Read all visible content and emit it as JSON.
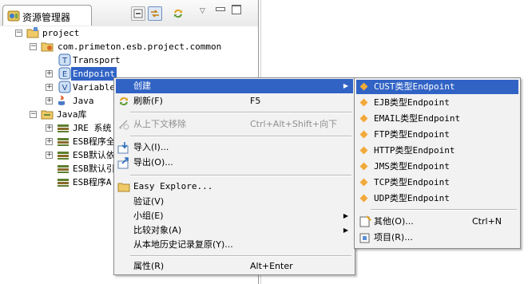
{
  "explorer": {
    "title": "资源管理器",
    "tree": {
      "project": "project",
      "package": "com.primeton.esb.project.common",
      "transport": "Transport",
      "endpoint": "Endpoint",
      "variable": "Variable",
      "java": "Java",
      "java_lib": "Java库",
      "jre": "JRE 系统",
      "esb_prog1": "ESB程序全",
      "esb_default1": "ESB默认依",
      "esb_default2": "ESB默认引",
      "esb_prog2": "ESB程序A"
    }
  },
  "context_menu": {
    "items": [
      {
        "label": "创建",
        "shortcut": "",
        "icon": "none",
        "submenu": true,
        "state": "highlighted"
      },
      {
        "label": "刷新(F)",
        "shortcut": "F5",
        "icon": "refresh-icon"
      },
      {
        "label": "从上下文移除",
        "shortcut": "Ctrl+Alt+Shift+向下",
        "icon": "remove-context-icon",
        "state": "disabled"
      },
      {
        "label": "导入(I)...",
        "shortcut": "",
        "icon": "import-icon"
      },
      {
        "label": "导出(O)...",
        "shortcut": "",
        "icon": "export-icon"
      },
      {
        "label": "Easy Explore...",
        "shortcut": "",
        "icon": "folder-icon"
      },
      {
        "label": "验证(V)",
        "shortcut": "",
        "icon": "none"
      },
      {
        "label": "小组(E)",
        "shortcut": "",
        "icon": "none",
        "submenu": true
      },
      {
        "label": "比较对象(A)",
        "shortcut": "",
        "icon": "none",
        "submenu": true
      },
      {
        "label": "从本地历史记录复原(Y)...",
        "shortcut": "",
        "icon": "none"
      },
      {
        "label": "属性(R)",
        "shortcut": "Alt+Enter",
        "icon": "none"
      }
    ]
  },
  "submenu": {
    "items": [
      {
        "label": "CUST类型Endpoint",
        "state": "highlighted"
      },
      {
        "label": "EJB类型Endpoint"
      },
      {
        "label": "EMAIL类型Endpoint"
      },
      {
        "label": "FTP类型Endpoint"
      },
      {
        "label": "HTTP类型Endpoint"
      },
      {
        "label": "JMS类型Endpoint"
      },
      {
        "label": "TCP类型Endpoint"
      },
      {
        "label": "UDP类型Endpoint"
      }
    ],
    "other": {
      "label": "其他(O)...",
      "shortcut": "Ctrl+N"
    },
    "project": {
      "label": "项目(R)..."
    }
  },
  "colors": {
    "selection": "#3163c5",
    "menu_bg": "#f2f2f2",
    "endpoint_bullet": "#f2a93b"
  }
}
